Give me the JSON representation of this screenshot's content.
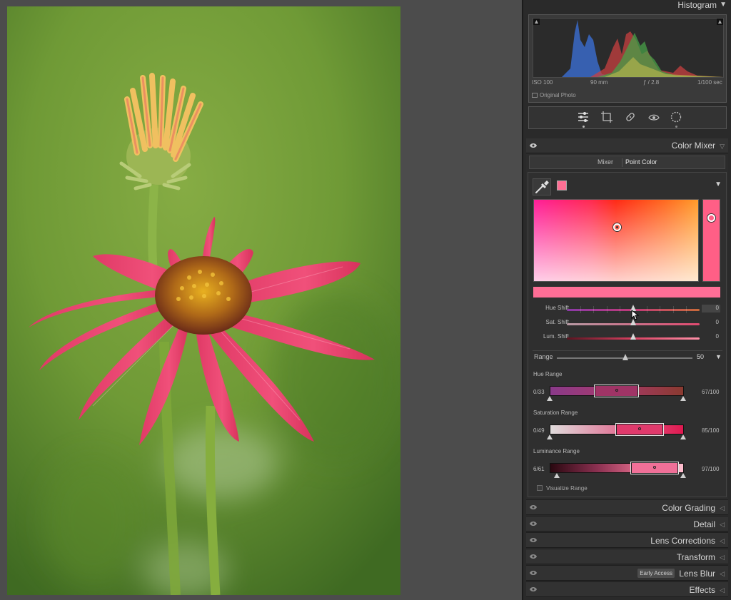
{
  "histogram": {
    "title": "Histogram",
    "iso": "ISO 100",
    "focal": "90 mm",
    "aperture": "ƒ / 2.8",
    "shutter": "1/100 sec",
    "original_photo": "Original Photo"
  },
  "toolbar": {
    "tools": [
      "edit-sliders-icon",
      "crop-icon",
      "healing-icon",
      "red-eye-icon",
      "masking-icon"
    ]
  },
  "color_mixer": {
    "title": "Color Mixer",
    "tabs": [
      "Mixer",
      "Point Color"
    ],
    "active_tab": "Point Color",
    "sampled_color": "#ff6f94",
    "hue_shift": {
      "label": "Hue Shift",
      "value": "0"
    },
    "sat_shift": {
      "label": "Sat. Shift",
      "value": "0"
    },
    "lum_shift": {
      "label": "Lum. Shift",
      "value": "0"
    },
    "range": {
      "label": "Range",
      "value": "50"
    },
    "hue_range": {
      "label": "Hue Range",
      "left": "0/33",
      "right": "67/100"
    },
    "saturation_range": {
      "label": "Saturation Range",
      "left": "0/49",
      "right": "85/100"
    },
    "luminance_range": {
      "label": "Luminance Range",
      "left": "6/61",
      "right": "97/100"
    },
    "visualize_range": "Visualize Range"
  },
  "sections": [
    {
      "title": "Color Grading"
    },
    {
      "title": "Detail"
    },
    {
      "title": "Lens Corrections"
    },
    {
      "title": "Transform"
    },
    {
      "title": "Lens Blur",
      "badge": "Early Access"
    },
    {
      "title": "Effects"
    }
  ],
  "colors": {
    "panel_bg": "#2a2a2a",
    "accent_pink": "#ff6e96",
    "photo_background": "#6f9a3a"
  }
}
